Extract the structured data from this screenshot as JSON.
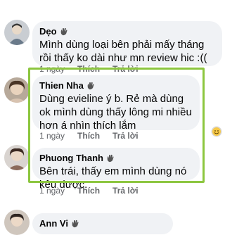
{
  "comments": [
    {
      "name": "Dẹo",
      "text": "Mình dùng loại bên phải mấy tháng rồi thấy ko dài như mn review hic :((",
      "time": "1 ngày",
      "like": "Thích",
      "reply": "Trả lời"
    },
    {
      "name": "Thien Nha",
      "text": "Dùng evieline ý b. Rẻ mà dùng ok mình dùng thấy lông mi nhiều hơn á nhìn thích lắm",
      "time": "1 ngày",
      "like": "Thích",
      "reply": "Trả lời"
    },
    {
      "name": "Phuong Thanh",
      "text": "Bên trái, thấy em mình dùng nó kêu được.",
      "time": "1 ngày",
      "like": "Thích",
      "reply": "Trả lời"
    },
    {
      "name": "Ann Vi",
      "text": "",
      "time": "",
      "like": "",
      "reply": ""
    }
  ],
  "colors": {
    "bubble": "#f0f2f5",
    "highlight": "#8cc63f",
    "meta": "#65676b"
  },
  "icons": [
    "badge-icon",
    "reaction-emoji-icon"
  ]
}
